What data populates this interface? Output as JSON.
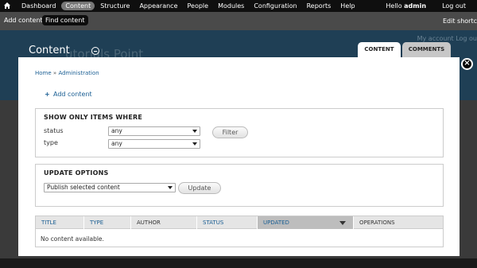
{
  "toolbar": {
    "home_icon": "home-icon",
    "items": [
      {
        "label": "Dashboard",
        "active": false
      },
      {
        "label": "Content",
        "active": true
      },
      {
        "label": "Structure",
        "active": false
      },
      {
        "label": "Appearance",
        "active": false
      },
      {
        "label": "People",
        "active": false
      },
      {
        "label": "Modules",
        "active": false
      },
      {
        "label": "Configuration",
        "active": false
      },
      {
        "label": "Reports",
        "active": false
      },
      {
        "label": "Help",
        "active": false
      }
    ],
    "hello_prefix": "Hello ",
    "user": "admin",
    "logout": "Log out"
  },
  "shortcuts": {
    "add_content": "Add content",
    "find_content": "Find content",
    "edit": "Edit shortc"
  },
  "background": {
    "site_name": "utorials Point",
    "links": "My account   Log ou"
  },
  "overlay": {
    "title": "Content",
    "tabs": {
      "content": "CONTENT",
      "comments": "COMMENTS"
    },
    "close_icon": "close-icon",
    "breadcrumb": {
      "home": "Home",
      "separator": "»",
      "admin": "Administration"
    },
    "add_content": "Add content",
    "filter": {
      "legend": "SHOW ONLY ITEMS WHERE",
      "status_label": "status",
      "status_value": "any",
      "type_label": "type",
      "type_value": "any",
      "button": "Filter"
    },
    "update": {
      "legend": "UPDATE OPTIONS",
      "select_value": "Publish selected content",
      "button": "Update"
    },
    "table": {
      "headers": [
        "TITLE",
        "TYPE",
        "AUTHOR",
        "STATUS",
        "UPDATED",
        "OPERATIONS"
      ],
      "empty": "No content available."
    }
  },
  "colors": {
    "toolbar_bg": "#0f0f0f",
    "shortcut_bg": "#4a4a4a",
    "link": "#1a5e93",
    "header_blue": "#1f3f55"
  }
}
